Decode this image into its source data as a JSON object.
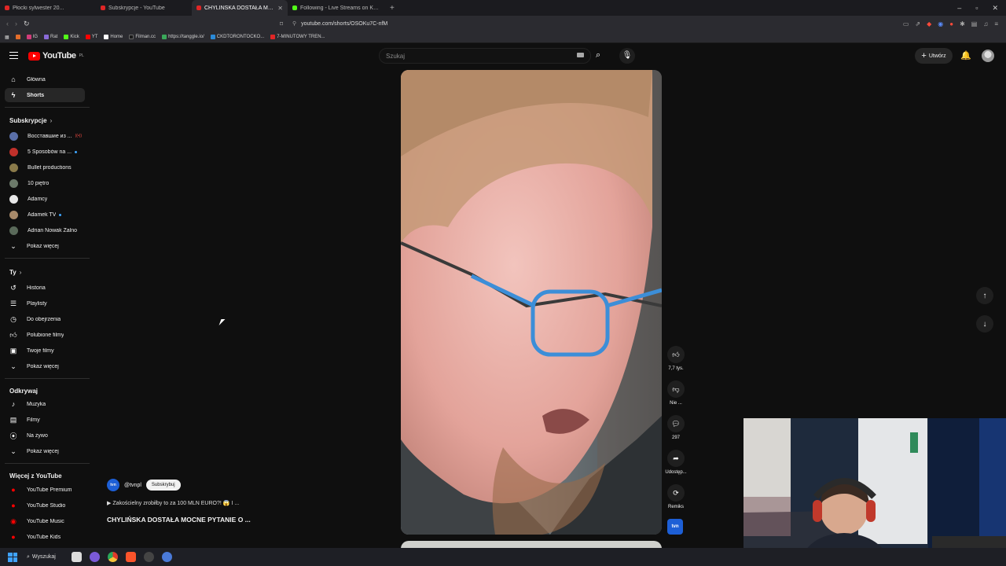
{
  "browser": {
    "tabs": [
      {
        "label": "Płocki sylwester 20...",
        "favicon": "red-favicon"
      },
      {
        "label": "Subskrypcje - YouTube",
        "favicon": "youtube-favicon"
      },
      {
        "label": "CHYLIŃSKA DOSTAŁA MOCNE...",
        "favicon": "youtube-favicon",
        "active": true
      },
      {
        "label": "Following - Live Streams on Kick",
        "favicon": "kick-favicon"
      }
    ],
    "url": "youtube.com/shorts/OSOKu7C-nfM",
    "bookmarks": [
      "IG",
      "Rat",
      "Kick",
      "YT",
      "Home",
      "Filman.cc",
      "https://tanggle.io/",
      "CKDTORONTOCKO...",
      "7-MINUTOWY TREN..."
    ]
  },
  "header": {
    "logo_text": "YouTube",
    "logo_region": "PL",
    "search_placeholder": "Szukaj",
    "create_label": "Utwórz"
  },
  "sidebar": {
    "main": [
      {
        "label": "Główna",
        "icon": "home-icon"
      },
      {
        "label": "Shorts",
        "icon": "shorts-icon",
        "active": true
      }
    ],
    "subscriptions_heading": "Subskrypcje",
    "subscriptions": [
      {
        "label": "Восставшие из ...",
        "badge": "live",
        "color": "#5a6fa8"
      },
      {
        "label": "5 Sposobów na ...",
        "badge": "new",
        "color": "#c0302a"
      },
      {
        "label": "Bullet productions",
        "badge": "",
        "color": "#8a7a4a"
      },
      {
        "label": "10 piętro",
        "badge": "",
        "color": "#6c7a6a"
      },
      {
        "label": "Adamcy",
        "badge": "",
        "color": "#e8e8e8"
      },
      {
        "label": "Adamek TV",
        "badge": "new",
        "color": "#a88a6a"
      },
      {
        "label": "Adrian Nowak Żalno",
        "badge": "",
        "color": "#5a6a5a"
      }
    ],
    "show_more_1": "Pokaż więcej",
    "you_heading": "Ty",
    "you": [
      {
        "label": "Historia",
        "icon": "history-icon"
      },
      {
        "label": "Playlisty",
        "icon": "playlist-icon"
      },
      {
        "label": "Do obejrzenia",
        "icon": "watch-later-icon"
      },
      {
        "label": "Polubione filmy",
        "icon": "like-icon"
      },
      {
        "label": "Twoje filmy",
        "icon": "your-videos-icon"
      }
    ],
    "show_more_2": "Pokaż więcej",
    "explore_heading": "Odkrywaj",
    "explore": [
      {
        "label": "Muzyka",
        "icon": "music-icon"
      },
      {
        "label": "Filmy",
        "icon": "film-icon"
      },
      {
        "label": "Na żywo",
        "icon": "live-icon"
      }
    ],
    "show_more_3": "Pokaż więcej",
    "more_heading": "Więcej z YouTube",
    "more": [
      {
        "label": "YouTube Premium"
      },
      {
        "label": "YouTube Studio"
      },
      {
        "label": "YouTube Music"
      },
      {
        "label": "YouTube Kids"
      }
    ]
  },
  "short": {
    "channel": "@tvnpl",
    "channel_badge": "tvn",
    "subscribe_label": "Subskrybuj",
    "description": "▶ Zakościelny zrobiłby to za 100 MLN EURO?! 😱 I ...",
    "title": "CHYLIŃSKA DOSTAŁA MOCNE PYTANIE O ...",
    "likes": "7,7 tys.",
    "dislike_label": "Nie ...",
    "comments": "297",
    "share_label": "Udostęp...",
    "remix_label": "Remiks"
  },
  "taskbar": {
    "search_label": "Wyszukaj"
  }
}
